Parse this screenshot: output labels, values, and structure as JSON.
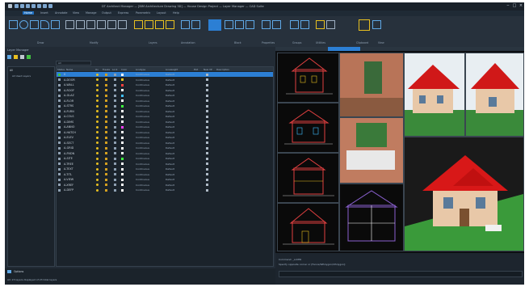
{
  "window": {
    "title": "DT Architect Manager — [BIM Architecture Drawing 3D] — House Design Project — Layer Manager — CAD Suite"
  },
  "menu_tabs": [
    "Home",
    "Insert",
    "Annotate",
    "View",
    "Manage",
    "Output",
    "Express",
    "Parametric",
    "Layout",
    "Help"
  ],
  "ribbon": {
    "groups": [
      "Draw",
      "Modify",
      "Layers",
      "Annotation",
      "Block",
      "Properties",
      "Groups",
      "Utilities",
      "Clipboard",
      "View"
    ]
  },
  "layer_panel": {
    "title": "Layer Manager",
    "filter_label": "All",
    "tree_root": "All",
    "tree_child": "All Used Layers",
    "columns": [
      "Status",
      "Name",
      "On",
      "Freeze",
      "Lock",
      "Color",
      "Linetype",
      "Lineweight",
      "Plot",
      "New VP",
      "Description"
    ]
  },
  "layers": [
    {
      "name": "0",
      "color": "#ffffff",
      "lt": "Continuous",
      "lw": "Default"
    },
    {
      "name": "A-DOOR",
      "color": "#e8c020",
      "lt": "Continuous",
      "lw": "Default"
    },
    {
      "name": "A-WALL",
      "color": "#ff4040",
      "lt": "Continuous",
      "lw": "Default"
    },
    {
      "name": "A-ROOF",
      "color": "#ffffff",
      "lt": "Continuous",
      "lw": "Default"
    },
    {
      "name": "A-GLAZ",
      "color": "#40c0ff",
      "lt": "Continuous",
      "lw": "Default"
    },
    {
      "name": "A-FLOR",
      "color": "#ffffff",
      "lt": "Continuous",
      "lw": "Default"
    },
    {
      "name": "A-STRS",
      "color": "#40ff40",
      "lt": "Continuous",
      "lw": "Default"
    },
    {
      "name": "A-FURN",
      "color": "#ffffff",
      "lt": "Continuous",
      "lw": "Default"
    },
    {
      "name": "A-COLS",
      "color": "#ffffff",
      "lt": "Continuous",
      "lw": "Default"
    },
    {
      "name": "A-DIMS",
      "color": "#ffffff",
      "lt": "Continuous",
      "lw": "Default"
    },
    {
      "name": "A-ANNO",
      "color": "#ff40ff",
      "lt": "Continuous",
      "lw": "Default"
    },
    {
      "name": "A-HATCH",
      "color": "#ffffff",
      "lt": "Continuous",
      "lw": "Default"
    },
    {
      "name": "A-ELEV",
      "color": "#ffffff",
      "lt": "Continuous",
      "lw": "Default"
    },
    {
      "name": "A-SECT",
      "color": "#ffffff",
      "lt": "Continuous",
      "lw": "Default"
    },
    {
      "name": "A-GRID",
      "color": "#ffffff",
      "lt": "Continuous",
      "lw": "Default"
    },
    {
      "name": "A-FNDN",
      "color": "#ffffff",
      "lt": "Continuous",
      "lw": "Default"
    },
    {
      "name": "A-SITE",
      "color": "#40ff40",
      "lt": "Continuous",
      "lw": "Default"
    },
    {
      "name": "A-TREE",
      "color": "#ffffff",
      "lt": "Continuous",
      "lw": "Default"
    },
    {
      "name": "A-TEXT",
      "color": "#ffffff",
      "lt": "Continuous",
      "lw": "Default"
    },
    {
      "name": "A-TITL",
      "color": "#ffffff",
      "lt": "Continuous",
      "lw": "Default"
    },
    {
      "name": "A-VIEW",
      "color": "#ffffff",
      "lt": "Continuous",
      "lw": "Default"
    },
    {
      "name": "A-XREF",
      "color": "#ffffff",
      "lt": "Continuous",
      "lw": "Default"
    },
    {
      "name": "A-DEFP",
      "color": "#ffffff",
      "lt": "Continuous",
      "lw": "Default"
    }
  ],
  "status": {
    "bottom_left": "Options",
    "bottom_text": "All: 23 layers displayed of 23 total layers"
  },
  "command": {
    "line1": "Command: _LAYER",
    "line2": "Specify opposite corner or [Fence/WPolygon/CPolygon]:"
  }
}
